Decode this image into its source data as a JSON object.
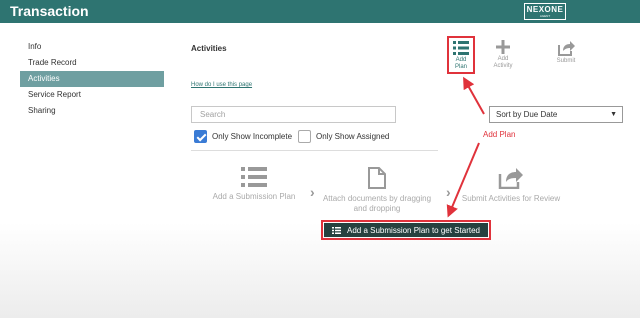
{
  "header": {
    "title": "Transaction",
    "logo_main": "NEXONE",
    "logo_sub": "AGENT"
  },
  "sidebar": {
    "items": [
      {
        "label": "Info",
        "active": false
      },
      {
        "label": "Trade Record",
        "active": false
      },
      {
        "label": "Activities",
        "active": true
      },
      {
        "label": "Service Report",
        "active": false
      },
      {
        "label": "Sharing",
        "active": false
      }
    ]
  },
  "main": {
    "title": "Activities",
    "help_link": "How do I use this page",
    "toolbar": {
      "add_plan": {
        "line1": "Add",
        "line2": "Plan",
        "icon": "list-icon"
      },
      "add_activity": {
        "line1": "Add",
        "line2": "Activity",
        "icon": "plus-icon"
      },
      "submit": {
        "label": "Submit",
        "icon": "share-icon"
      }
    },
    "search": {
      "placeholder": "Search",
      "value": ""
    },
    "sort": {
      "selected": "Sort by Due Date"
    },
    "filters": {
      "only_incomplete": {
        "label": "Only Show Incomplete",
        "checked": true
      },
      "only_assigned": {
        "label": "Only Show Assigned",
        "checked": false
      }
    },
    "steps": {
      "step1": "Add a Submission Plan",
      "step2_line1": "Attach documents by dragging",
      "step2_line2": "and dropping",
      "step3": "Submit Activities for Review"
    },
    "cta_label": "Add a Submission Plan to get Started"
  },
  "annotation": {
    "label": "Add Plan",
    "color": "#e0323b"
  },
  "colors": {
    "header": "#2e7471",
    "active_nav": "#6f9fa1",
    "cta": "#26413f",
    "checkbox": "#3a7bd5"
  }
}
